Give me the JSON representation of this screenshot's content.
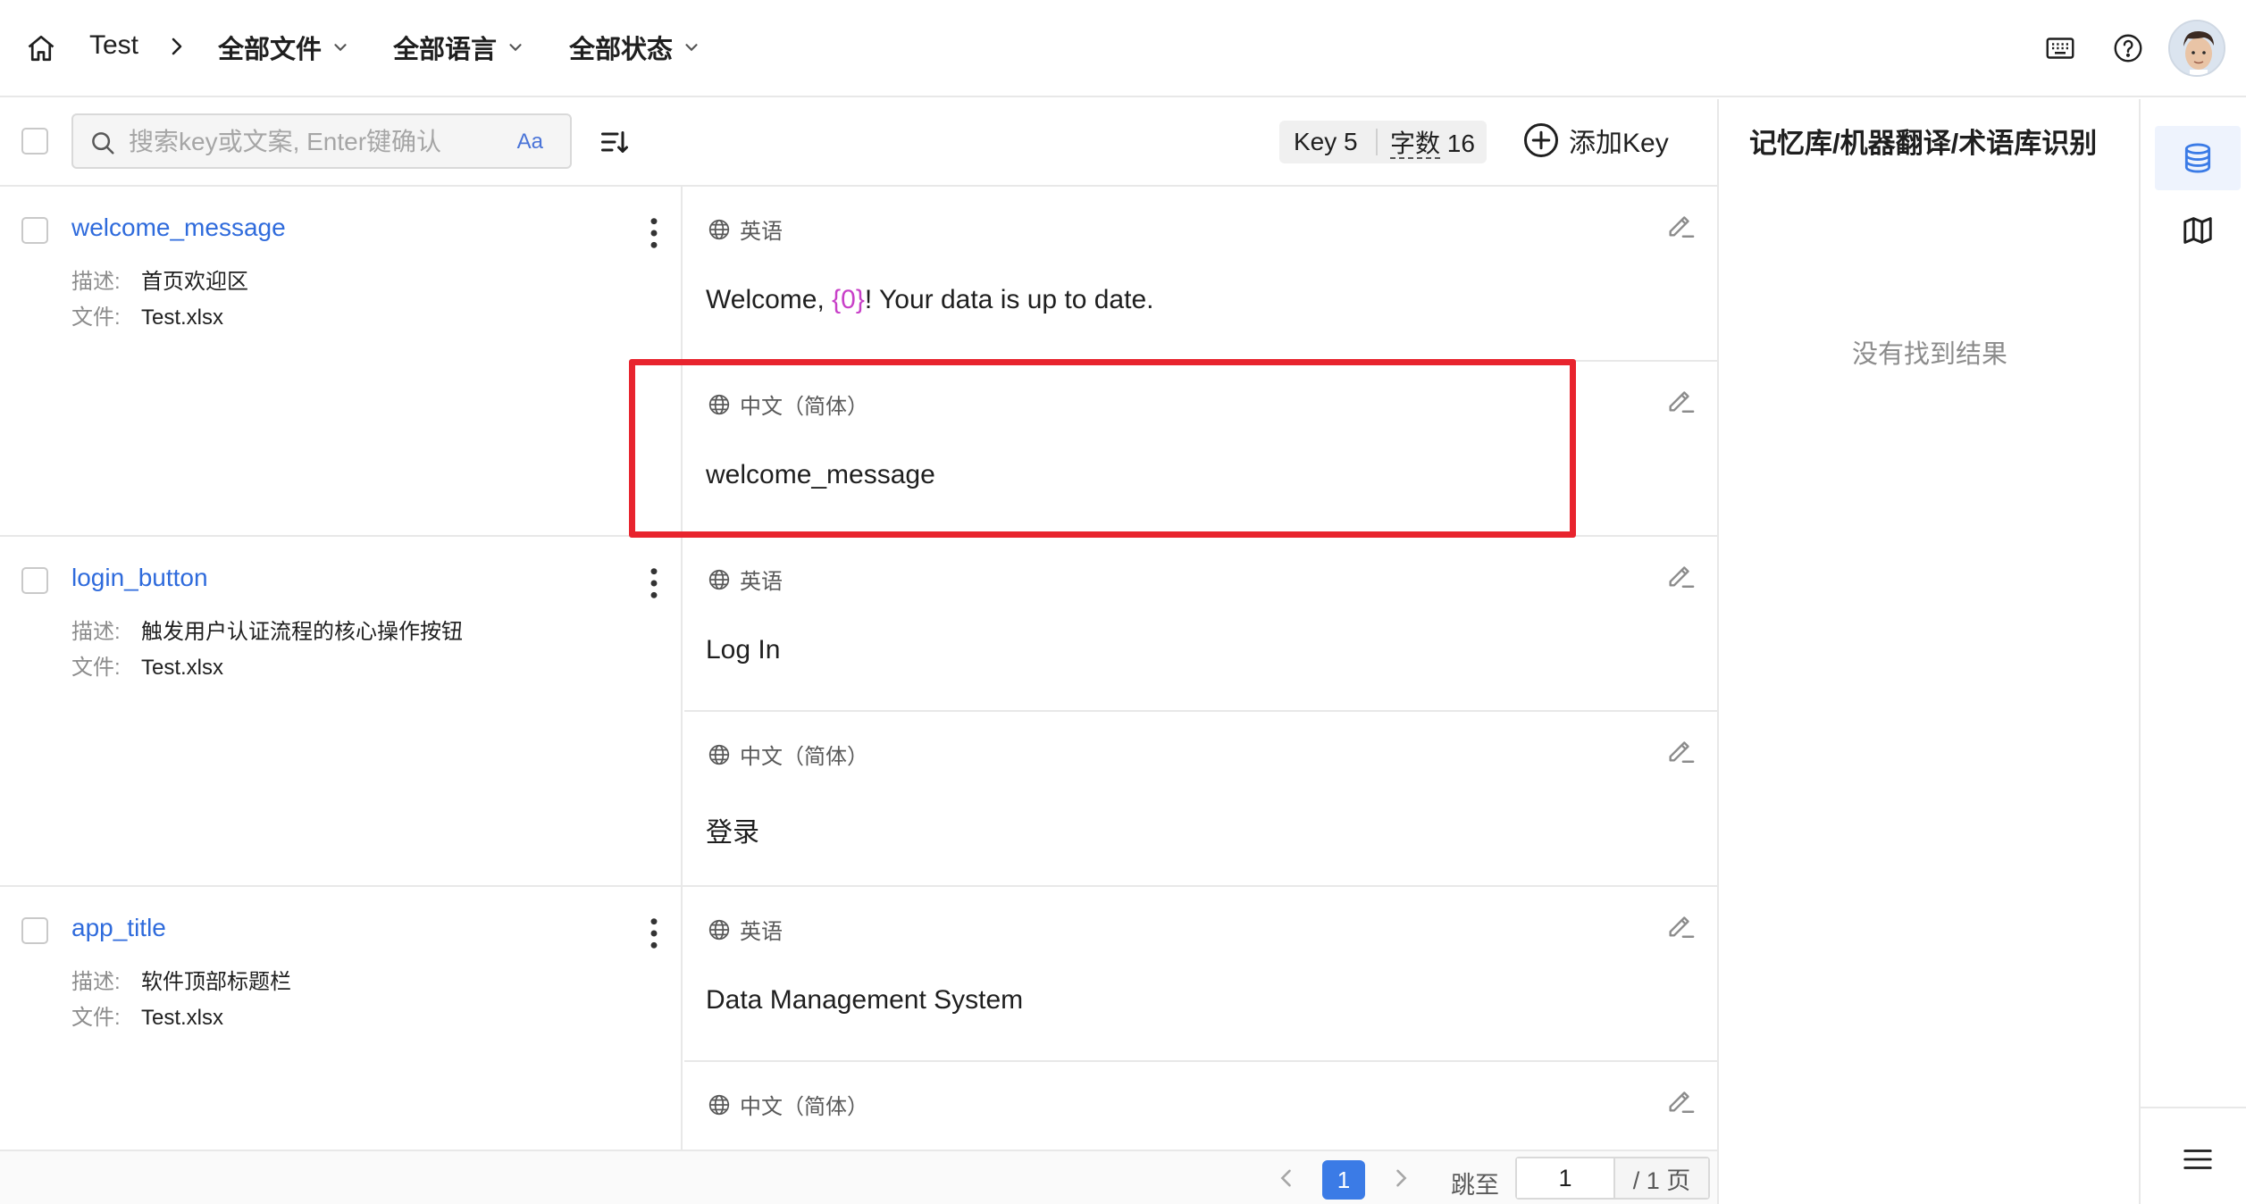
{
  "header": {
    "project": "Test",
    "filters": [
      "全部文件",
      "全部语言",
      "全部状态"
    ]
  },
  "toolbar": {
    "search_placeholder": "搜索key或文案, Enter键确认",
    "case_toggle": "Aa",
    "key_count": "Key 5",
    "word_label": "字数",
    "word_count": "16",
    "add_key": "添加Key"
  },
  "rows": [
    {
      "key": "welcome_message",
      "desc_label": "描述:",
      "desc": "首页欢迎区",
      "file_label": "文件:",
      "file": "Test.xlsx",
      "translations": [
        {
          "lang": "英语",
          "pre": "Welcome, ",
          "placeholder": "{0}",
          "post": "! Your data is up to date."
        },
        {
          "lang": "中文（简体）",
          "pre": "welcome_message",
          "placeholder": "",
          "post": ""
        }
      ]
    },
    {
      "key": "login_button",
      "desc_label": "描述:",
      "desc": "触发用户认证流程的核心操作按钮",
      "file_label": "文件:",
      "file": "Test.xlsx",
      "translations": [
        {
          "lang": "英语",
          "pre": "Log In",
          "placeholder": "",
          "post": ""
        },
        {
          "lang": "中文（简体）",
          "pre": "登录",
          "placeholder": "",
          "post": ""
        }
      ]
    },
    {
      "key": "app_title",
      "desc_label": "描述:",
      "desc": "软件顶部标题栏",
      "file_label": "文件:",
      "file": "Test.xlsx",
      "translations": [
        {
          "lang": "英语",
          "pre": "Data Management System",
          "placeholder": "",
          "post": ""
        },
        {
          "lang": "中文（简体）",
          "pre": "",
          "placeholder": "",
          "post": ""
        }
      ]
    }
  ],
  "pagination": {
    "current": "1",
    "jump_label": "跳至",
    "jump_value": "1",
    "total": "/ 1 页"
  },
  "side_panel": {
    "title": "记忆库/机器翻译/术语库识别",
    "empty": "没有找到结果"
  },
  "colors": {
    "link": "#2f6bdc",
    "placeholder_token": "#c840c8",
    "highlight": "#e8242e",
    "primary": "#3b7be6"
  },
  "icons": [
    "home-icon",
    "chevron-right-icon",
    "chevron-down-icon",
    "keyboard-icon",
    "help-icon",
    "search-icon",
    "sort-icon",
    "plus-circle-icon",
    "more-vertical-icon",
    "globe-icon",
    "edit-icon",
    "database-icon",
    "map-icon",
    "menu-icon"
  ]
}
